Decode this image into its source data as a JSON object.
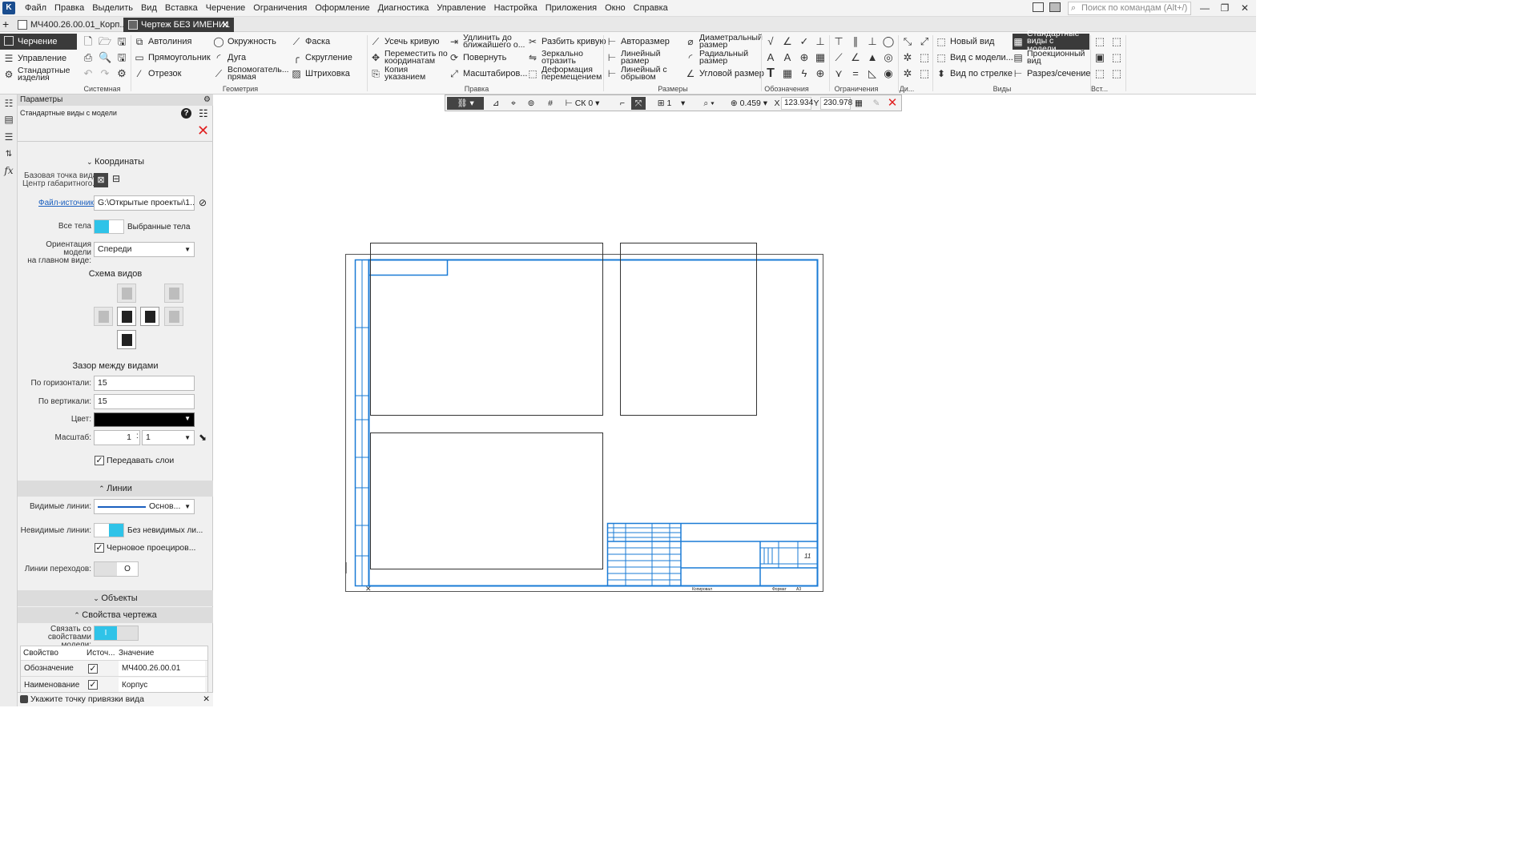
{
  "menu": {
    "items": [
      "Файл",
      "Правка",
      "Выделить",
      "Вид",
      "Вставка",
      "Черчение",
      "Ограничения",
      "Оформление",
      "Диагностика",
      "Управление",
      "Настройка",
      "Приложения",
      "Окно",
      "Справка"
    ],
    "search_placeholder": "Поиск по командам (Alt+/)"
  },
  "tabs": [
    {
      "label": "МЧ400.26.00.01_Корп..."
    },
    {
      "label": "Чертеж БЕЗ ИМЕНИ1"
    }
  ],
  "ribbon": {
    "modes": [
      "Черчение",
      "Управление",
      "Стандартные изделия"
    ],
    "geometry": [
      "Автолиния",
      "Окружность",
      "Фаска",
      "Прямоугольник",
      "Дуга",
      "Скругление",
      "Отрезок",
      "Вспомогатель... прямая",
      "Штриховка"
    ],
    "edit": [
      "Усечь кривую",
      "Удлинить до ближайшего о...",
      "Разбить кривую",
      "Переместить по координатам",
      "Повернуть",
      "Зеркально отразить",
      "Копия указанием",
      "Масштабиров...",
      "Деформация перемещением"
    ],
    "dims": [
      "Авторазмер",
      "Диаметральный размер",
      "Линейный размер",
      "Радиальный размер",
      "Линейный с обрывом",
      "Угловой размер"
    ],
    "views": [
      "Новый вид",
      "Стандартные виды с модели...",
      "Вид с модели...",
      "Проекционный вид",
      "Вид по стрелке",
      "Разрез/сечение"
    ],
    "groups": [
      "Системная",
      "Геометрия",
      "Правка",
      "Размеры",
      "Обозначения",
      "Ограничения",
      "Ди...",
      "Виды",
      "Вст..."
    ]
  },
  "panel": {
    "header": "Параметры",
    "subheader": "Стандартные виды с модели",
    "coordinates_title": "Координаты",
    "base_point_label": "Базовая точка вида:",
    "base_point_value": "Центр габаритного...",
    "source_file_label": "Файл-источник",
    "source_file_value": "G:\\Открытые проекты\\1...",
    "all_bodies_label": "Все тела",
    "selected_bodies_label": "Выбранные тела",
    "orientation_label_1": "Ориентация модели",
    "orientation_label_2": "на главном виде:",
    "orientation_value": "Спереди",
    "views_scheme_title": "Схема видов",
    "gap_title": "Зазор между видами",
    "horizontal_label": "По горизонтали:",
    "horizontal_value": "15",
    "vertical_label": "По вертикали:",
    "vertical_value": "15",
    "color_label": "Цвет:",
    "scale_label": "Масштаб:",
    "scale_num": "1",
    "scale_den": "1",
    "pass_layers_label": "Передавать слои",
    "lines_section": "Линии",
    "visible_lines_label": "Видимые линии:",
    "visible_lines_value": "Основ...",
    "hidden_lines_label": "Невидимые линии:",
    "hidden_lines_value": "Без невидимых ли...",
    "draft_projection_label": "Черновое проециров...",
    "transition_lines_label": "Линии переходов:",
    "objects_section": "Объекты",
    "drawing_props_section": "Свойства чертежа",
    "link_props_label_1": "Связать со",
    "link_props_label_2": "свойствами модели:",
    "table_headers": [
      "Свойство",
      "Источ...",
      "Значение"
    ],
    "table_rows": [
      {
        "property": "Обозначение",
        "value": "МЧ400.26.00.01"
      },
      {
        "property": "Наименование",
        "value": "Корпус"
      }
    ]
  },
  "snapbar": {
    "cs": "СК 0",
    "layer": "1",
    "zoom": "0.459",
    "x_label": "X",
    "x_value": "123.934",
    "y_label": "Y",
    "y_value": "230.978"
  },
  "status": "Укажите точку привязки вида",
  "drawing": {
    "sheet_number": "11",
    "format_label": "Формат",
    "format_value": "А3",
    "copied_label": "Копировал"
  },
  "colors": {
    "accent": "#2fc3e8",
    "frame_blue": "#1a7bd6",
    "dark_tab": "#3a3a3a"
  }
}
